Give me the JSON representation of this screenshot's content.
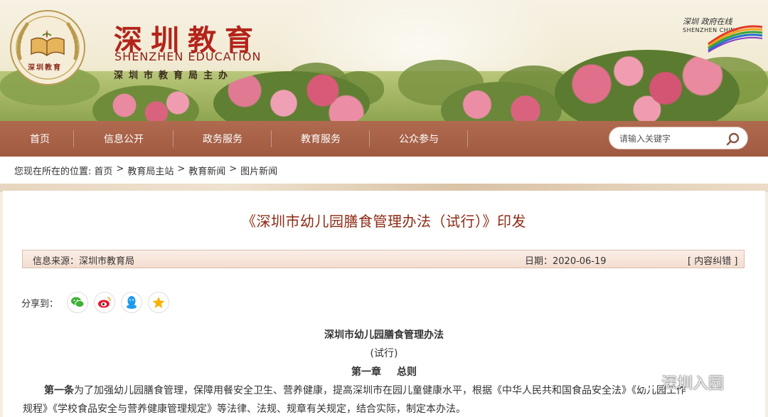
{
  "brand": {
    "cn_name": "深圳教育",
    "en_name": "SHENZHEN EDUCATION",
    "sub_title": "深圳市教育局主办",
    "emblem_text": "深圳教育",
    "partner_logo_cn": "深圳 政府在线",
    "partner_logo_en": "SHENZHEN CHINA"
  },
  "nav": {
    "items": [
      {
        "label": "首页"
      },
      {
        "label": "信息公开"
      },
      {
        "label": "政务服务"
      },
      {
        "label": "教育服务"
      },
      {
        "label": "公众参与"
      }
    ],
    "search_placeholder": "请输入关键字"
  },
  "breadcrumb": {
    "prefix": "您现在所在的位置:",
    "items": [
      "首页",
      "教育局主站",
      "教育新闻",
      "图片新闻"
    ],
    "separator": ">"
  },
  "article": {
    "title": "《深圳市幼儿园膳食管理办法（试行）》印发",
    "source": "信息来源：深圳市教育局",
    "date": "日期：2020-06-19",
    "correction": "[ 内容纠错 ]",
    "share_label": "分享到：",
    "share_icons": [
      "wechat-icon",
      "weibo-icon",
      "qq-icon",
      "qzone-icon"
    ],
    "doc_title": "深圳市幼儿园膳食管理办法",
    "doc_subtitle": "(试行)",
    "chapter_no": "第一章",
    "chapter_name": "总则",
    "para_lead": "第一条",
    "para_line1": "为了加强幼儿园膳食管理，保障用餐安全卫生、营养健康，提高深圳市在园儿童健康水平，根据《中华人民共和国食品安全法》《幼儿园工作",
    "para_line2": "规程》《学校食品安全与营养健康管理规定》等法律、法规、规章有关规定，结合实际，制定本办法。"
  },
  "watermark": {
    "text": "深圳入园"
  },
  "colors": {
    "nav_bg": "#a9634a",
    "title_red": "#8d2a14",
    "brand_red": "#b3241b",
    "info_bar_bg": "#f6e4da"
  }
}
